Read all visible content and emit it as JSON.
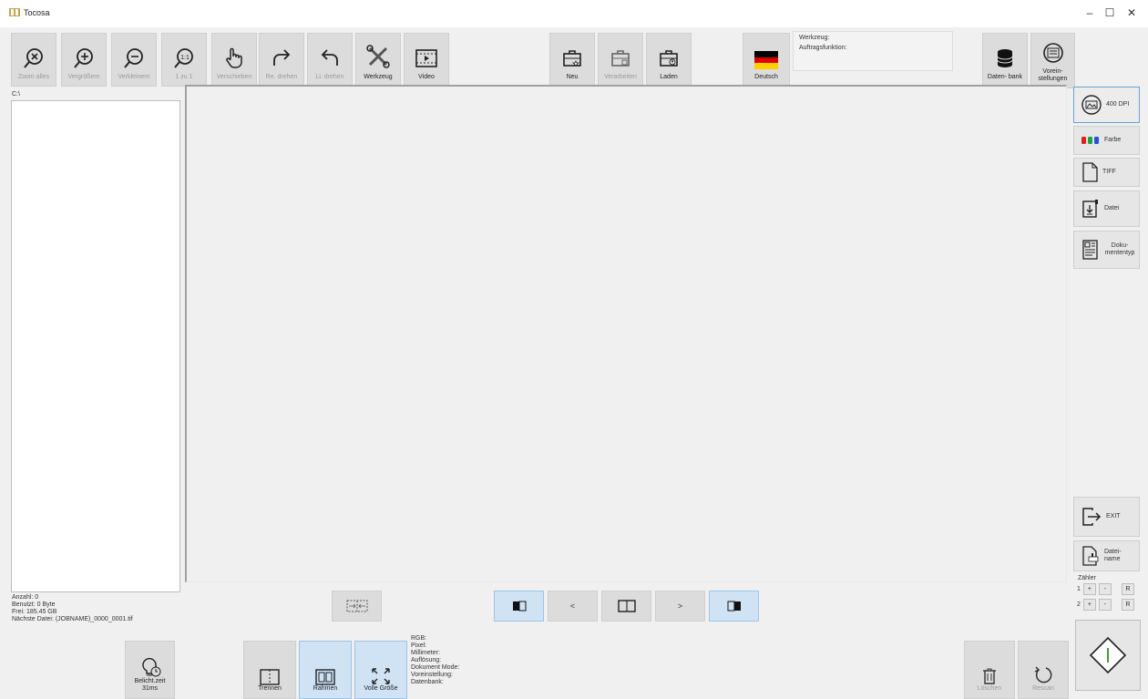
{
  "window": {
    "title": "Tocosa",
    "minimize": "–",
    "maximize": "☐",
    "close": "✕"
  },
  "toolbar": {
    "zoom_all": "Zoom alles",
    "zoom_in": "Vergrößern",
    "zoom_out": "Verkleinern",
    "one_to_one": "1 zu 1",
    "move": "Verschieben",
    "rotate_right": "Re. drehen",
    "rotate_left": "Li. drehen",
    "tool": "Werkzeug",
    "video": "Video",
    "new": "Neu",
    "process": "Verarbeiten",
    "load": "Laden",
    "language": "Deutsch",
    "database": "Daten- bank",
    "presets": "Vorein- stellungen"
  },
  "info_panel": {
    "tool_label": "Werkzeug:",
    "job_function_label": "Auftragsfunktion:"
  },
  "file_panel": {
    "path": "C:\\",
    "count": "Anzahl: 0",
    "used": "Benutzt: 0 Byte",
    "free": "Frei: 185.45 GB",
    "next_file": "Nächste Datei: (JOBNAME)_0000_0001.tif"
  },
  "sidebar": {
    "dpi": "400 DPI",
    "color": "Farbe",
    "format": "TIFF",
    "file": "Datei",
    "doctype": "Doku- mententyp",
    "exit": "EXIT",
    "filename": "Datei- name"
  },
  "counter": {
    "label": "Zähler",
    "rows": [
      {
        "index": "1",
        "plus": "+",
        "minus": "-",
        "reset": "R"
      },
      {
        "index": "2",
        "plus": "+",
        "minus": "-",
        "reset": "R"
      }
    ]
  },
  "nav": {
    "prev": "<",
    "next": ">"
  },
  "bottom": {
    "exposure": "Belicht.zeit 31ms",
    "split": "Trennen",
    "frame": "Rahmen",
    "full_size": "Volle Größe",
    "delete": "Löschen",
    "rescan": "Rescan"
  },
  "status": {
    "rgb": "RGB:",
    "pixel": "Pixel:",
    "millimeter": "Millimeter:",
    "resolution": "Auflösung:",
    "document_mode": "Dokument Mode:",
    "preset": "Voreinstellung:",
    "database": "Datenbank:"
  },
  "colors": {
    "accent_blue": "#cfe3f5",
    "flag_black": "#000000",
    "flag_red": "#dd0000",
    "flag_gold": "#ffce00",
    "scan_green": "#3aa03a"
  }
}
